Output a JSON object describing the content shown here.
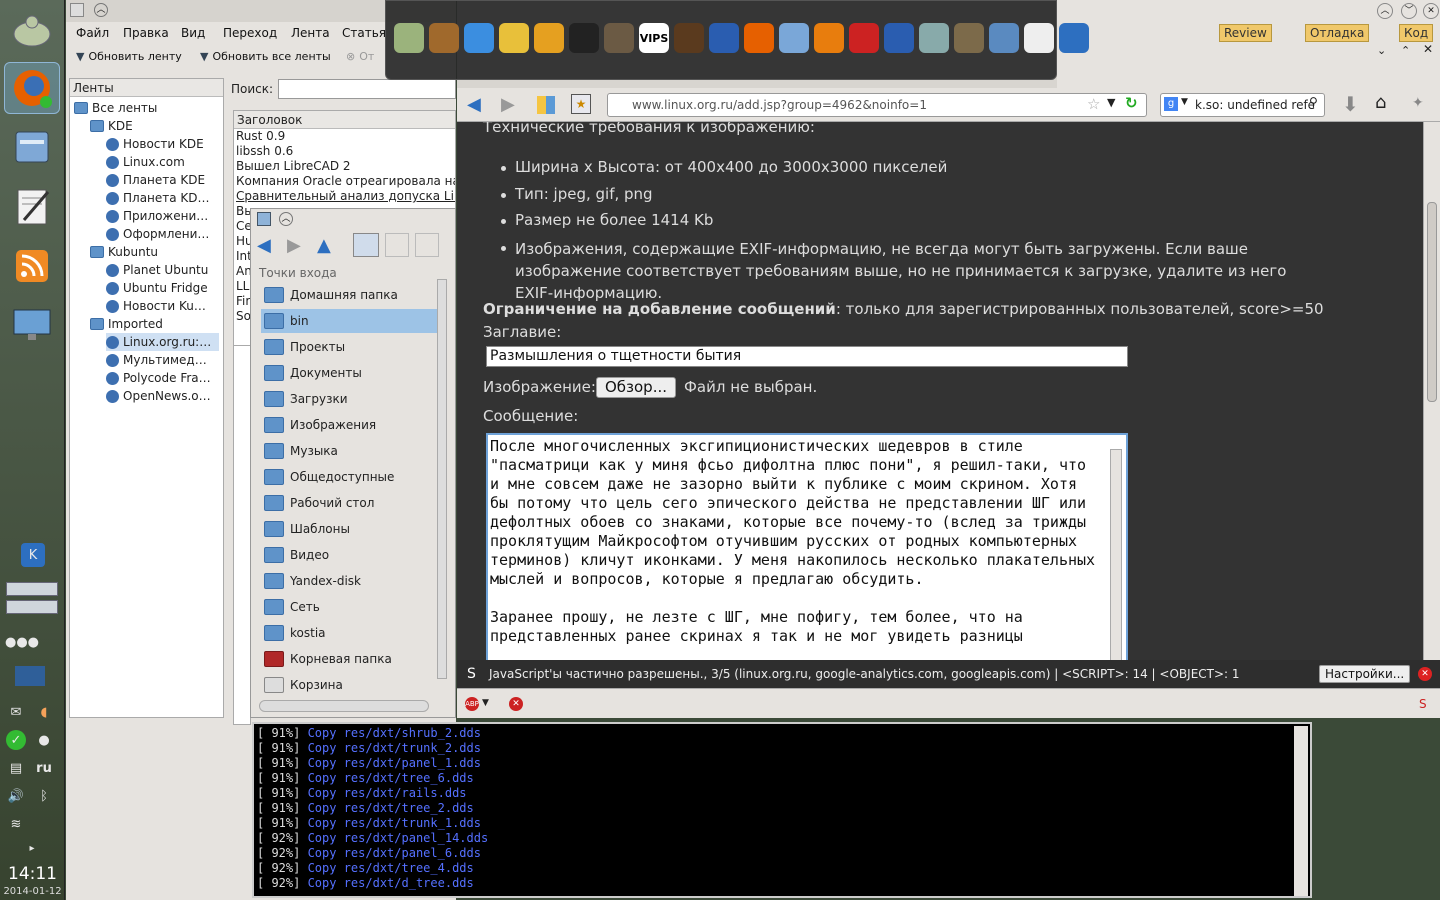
{
  "panel": {
    "clock": "14:11",
    "date": "2014-01-12",
    "lang": "ru"
  },
  "akregator": {
    "menu": [
      "Файл",
      "Правка",
      "Вид",
      "Переход",
      "Лента",
      "Статья"
    ],
    "toolbar": {
      "refresh_feed": "Обновить ленту",
      "refresh_all": "Обновить все ленты",
      "other": "От"
    },
    "feeds_header": "Ленты",
    "search_label": "Поиск:",
    "tree": [
      {
        "label": "Все ленты",
        "level": 0,
        "icon": "folder"
      },
      {
        "label": "KDE",
        "level": 1,
        "icon": "folder"
      },
      {
        "label": "Новости KDE",
        "level": 2,
        "icon": "feed"
      },
      {
        "label": "Linux.com",
        "level": 2,
        "icon": "feed"
      },
      {
        "label": "Планета KDE",
        "level": 2,
        "icon": "feed"
      },
      {
        "label": "Планета KD…",
        "level": 2,
        "icon": "feed"
      },
      {
        "label": "Приложени…",
        "level": 2,
        "icon": "feed"
      },
      {
        "label": "Оформлени…",
        "level": 2,
        "icon": "feed"
      },
      {
        "label": "Kubuntu",
        "level": 1,
        "icon": "folder"
      },
      {
        "label": "Planet Ubuntu",
        "level": 2,
        "icon": "feed"
      },
      {
        "label": "Ubuntu Fridge",
        "level": 2,
        "icon": "feed"
      },
      {
        "label": "Новости Ku…",
        "level": 2,
        "icon": "feed"
      },
      {
        "label": "Imported",
        "level": 1,
        "icon": "folder"
      },
      {
        "label": "Linux.org.ru:…",
        "level": 2,
        "icon": "feed"
      },
      {
        "label": "Мультимед…",
        "level": 2,
        "icon": "feed"
      },
      {
        "label": "Polycode Fra…",
        "level": 2,
        "icon": "feed"
      },
      {
        "label": "OpenNews.o…",
        "level": 2,
        "icon": "feed"
      }
    ],
    "articles_header": "Заголовок",
    "articles": [
      "Rust 0.9",
      "libssh 0.6",
      "Вышел LibreCAD 2",
      "Компания Oracle отреагировала на пе",
      "Сравнительный анализ допуска Linux",
      "Вы",
      "Се",
      "Hu",
      "Int",
      "An",
      "LLI",
      "Fir",
      "So"
    ]
  },
  "dolphin": {
    "places_header": "Точки входа",
    "places": [
      "Домашняя папка",
      "bin",
      "Проекты",
      "Документы",
      "Загрузки",
      "Изображения",
      "Музыка",
      "Общедоступные",
      "Рабочий стол",
      "Шаблоны",
      "Видео",
      "Yandex-disk",
      "Сеть",
      "kostia",
      "Корневая папка",
      "Корзина"
    ]
  },
  "terminal": {
    "lines": [
      {
        "pct": "[ 91%] ",
        "cmd": "Copy res/dxt/shrub_2.dds"
      },
      {
        "pct": "[ 91%] ",
        "cmd": "Copy res/dxt/trunk_2.dds"
      },
      {
        "pct": "[ 91%] ",
        "cmd": "Copy res/dxt/panel_1.dds"
      },
      {
        "pct": "[ 91%] ",
        "cmd": "Copy res/dxt/tree_6.dds"
      },
      {
        "pct": "[ 91%] ",
        "cmd": "Copy res/dxt/rails.dds"
      },
      {
        "pct": "[ 91%] ",
        "cmd": "Copy res/dxt/tree_2.dds"
      },
      {
        "pct": "[ 91%] ",
        "cmd": "Copy res/dxt/trunk_1.dds"
      },
      {
        "pct": "[ 92%] ",
        "cmd": "Copy res/dxt/panel_14.dds"
      },
      {
        "pct": "[ 92%] ",
        "cmd": "Copy res/dxt/panel_6.dds"
      },
      {
        "pct": "[ 92%] ",
        "cmd": "Copy res/dxt/tree_4.dds"
      },
      {
        "pct": "[ 92%] ",
        "cmd": "Copy res/dxt/d_tree.dds"
      }
    ]
  },
  "dock": {
    "vips": "VIPS"
  },
  "right_tabs": {
    "review": "Review",
    "debug": "Отладка",
    "code": "Код"
  },
  "firefox": {
    "url": "www.linux.org.ru/add.jsp?group=4962&noinfo=1",
    "search": "k.so: undefined refe",
    "req_heading": "Технические требования к изображению:",
    "requirements": [
      "Ширина x Высота: от 400x400 до 3000x3000 пикселей",
      "Тип: jpeg, gif, png",
      "Размер не более 1414 Kb",
      "Изображения, содержащие EXIF-информацию, не всегда могут быть загружены. Если ваше изображение соответствует требованиям выше, но не принимается к загрузке, удалите из него EXIF-информацию."
    ],
    "limit_bold": "Ограничение на добавление сообщений",
    "limit_rest": ": только для зарегистрированных пользователей, score>=50",
    "title_label": "Заглавие:",
    "title_value": "Размышления о тщетности бытия",
    "image_label": "Изображение:",
    "browse_btn": "Обзор...",
    "no_file": "Файл не выбран.",
    "message_label": "Сообщение:",
    "message": "После многочисленных эксгипиционистических шедевров в стиле \"пасматрици как у миня фсьо дифолтна плюс пони\", я решил-таки, что и мне совсем даже не зазорно выйти к публике с моим скрином. Хотя бы потому что цель сего эпического действа не представлении ШГ или дефолтных обоев со знаками, которые все почему-то (вслед за трижды проклятущим Майкрософтом отучившим русских от родных компьютерных терминов) кличут иконками. У меня накопилось несколько плакательных мыслей и вопросов, которые я предлагаю обсудить.\n\nЗаранее прошу, не лезте с ШГ, мне пофигу, тем более, что на представленных ранее скринах я так и не мог увидеть разницы",
    "noscript": "JavaScript'ы частично разрешены., 3/5 (linux.org.ru, google-analytics.com, googleapis.com) | <SCRIPT>: 14 | <OBJECT>: 1",
    "settings_btn": "Настройки..."
  }
}
